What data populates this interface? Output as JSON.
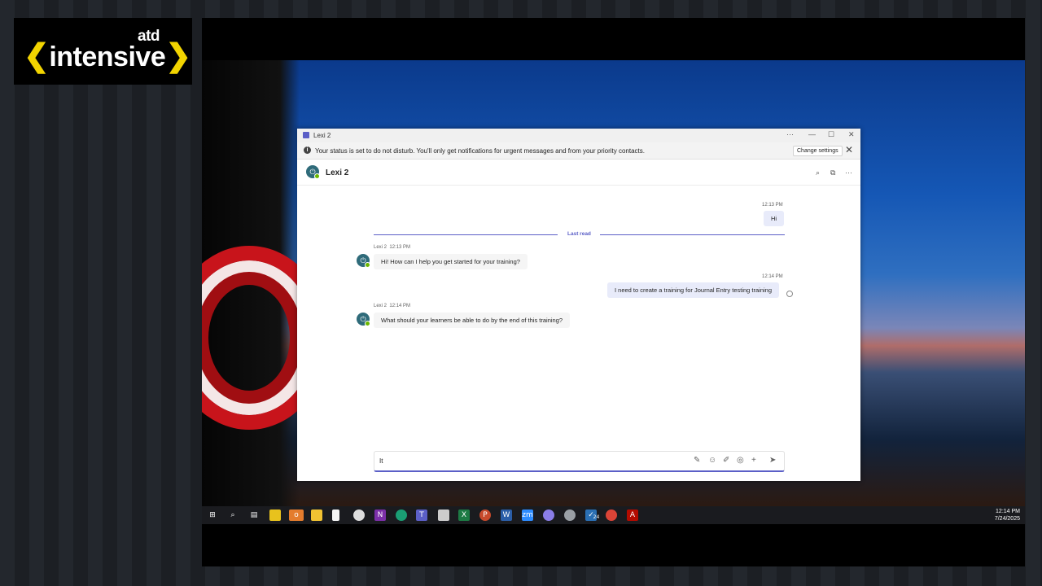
{
  "overlay": {
    "logo_small": "atd",
    "logo_main": "intensive",
    "logo_left_bracket": "❮",
    "logo_right_bracket": "❯",
    "brand_accent": "#f2d400"
  },
  "window": {
    "title": "Lexi 2",
    "controls": [
      "···",
      "—",
      "☐",
      "✕"
    ]
  },
  "notice": {
    "text": "Your status is set to do not disturb. You'll only get notifications for urgent messages and from your priority contacts.",
    "button": "Change settings",
    "close": "✕"
  },
  "chat": {
    "name": "Lexi 2",
    "header_icons": [
      "search-icon",
      "popout-icon",
      "more-icon"
    ],
    "last_read": "Last read",
    "messages": [
      {
        "from": "me",
        "time": "12:13 PM",
        "text": "Hi"
      },
      {
        "from": "bot",
        "sender": "Lexi 2",
        "time": "12:13 PM",
        "text": "Hi! How can I help you get started for your training?"
      },
      {
        "from": "me",
        "time": "12:14 PM",
        "text": "I need to create a training for Journal Entry testing training"
      },
      {
        "from": "bot",
        "sender": "Lexi 2",
        "time": "12:14 PM",
        "text": "What should your learners be able to do by the end of this training?"
      }
    ]
  },
  "compose": {
    "value": "It",
    "icons": [
      "format-icon",
      "emoji-icon",
      "sticker-icon",
      "loop-icon",
      "plus-icon",
      "send-icon"
    ]
  },
  "taskbar": {
    "time": "12:14 PM",
    "date": "7/24/2025",
    "badge": "24"
  },
  "colors": {
    "teams_accent": "#5b5fc7",
    "my_bubble": "#e8ebfa",
    "bot_bubble": "#f5f5f5"
  }
}
